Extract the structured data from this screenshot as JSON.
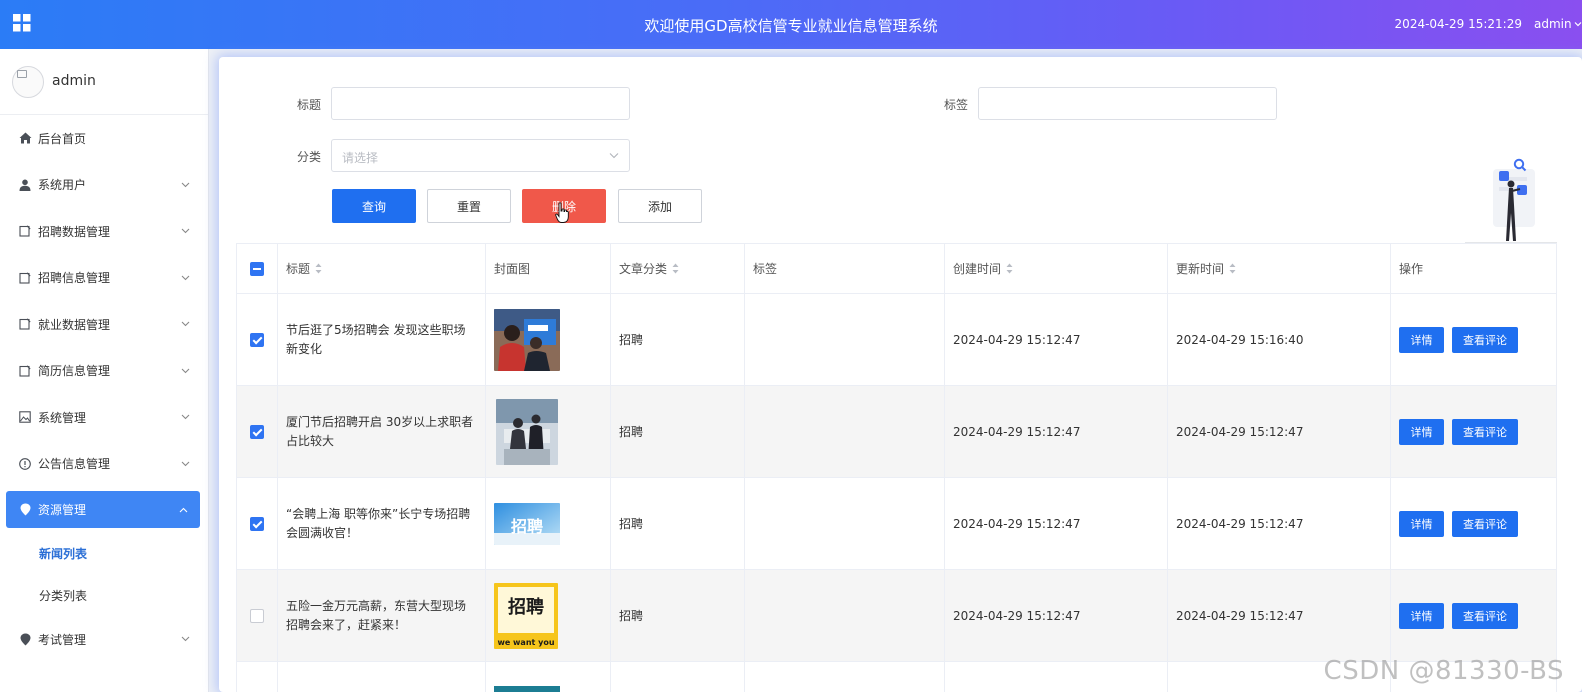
{
  "header": {
    "title": "欢迎使用GD高校信管专业就业信息管理系统",
    "datetime": "2024-04-29 15:21:29",
    "user": "admin"
  },
  "sidebar": {
    "username": "admin",
    "items": [
      {
        "label": "后台首页",
        "icon": "home-icon"
      },
      {
        "label": "系统用户",
        "icon": "user-icon"
      },
      {
        "label": "招聘数据管理",
        "icon": "document-icon"
      },
      {
        "label": "招聘信息管理",
        "icon": "document-icon"
      },
      {
        "label": "就业数据管理",
        "icon": "document-icon"
      },
      {
        "label": "简历信息管理",
        "icon": "document-icon"
      },
      {
        "label": "系统管理",
        "icon": "image-icon"
      },
      {
        "label": "公告信息管理",
        "icon": "info-icon"
      },
      {
        "label": "资源管理",
        "icon": "location-icon"
      },
      {
        "label": "考试管理",
        "icon": "location-icon"
      }
    ],
    "submenu": [
      "新闻列表",
      "分类列表"
    ]
  },
  "search": {
    "title_label": "标题",
    "tag_label": "标签",
    "category_label": "分类",
    "category_placeholder": "请选择",
    "query_label": "查询",
    "reset_label": "重置",
    "delete_label": "删除",
    "add_label": "添加"
  },
  "table": {
    "headers": [
      "标题",
      "封面图",
      "文章分类",
      "标签",
      "创建时间",
      "更新时间",
      "操作"
    ],
    "rows": [
      {
        "checked": true,
        "title": "节后逛了5场招聘会 发现这些职场新变化",
        "category": "招聘",
        "tag": "",
        "created": "2024-04-29 15:12:47",
        "updated": "2024-04-29 15:16:40"
      },
      {
        "checked": true,
        "title": "厦门节后招聘开启 30岁以上求职者占比较大",
        "category": "招聘",
        "tag": "",
        "created": "2024-04-29 15:12:47",
        "updated": "2024-04-29 15:12:47"
      },
      {
        "checked": true,
        "title": "“会聘上海 职等你来”长宁专场招聘会圆满收官！",
        "category": "招聘",
        "tag": "",
        "created": "2024-04-29 15:12:47",
        "updated": "2024-04-29 15:12:47"
      },
      {
        "checked": false,
        "title": "五险一金万元高薪，东营大型现场招聘会来了，赶紧来！",
        "category": "招聘",
        "tag": "",
        "created": "2024-04-29 15:12:47",
        "updated": "2024-04-29 15:12:47"
      }
    ],
    "detail_label": "详情",
    "comments_label": "查看评论"
  },
  "thumb_texts": {
    "poster3": "招聘",
    "poster4_big": "招聘",
    "poster4_small": "we want you"
  },
  "watermark": "CSDN @81330-BS",
  "colors": {
    "header_gradient_start": "#2b7cf6",
    "header_gradient_end": "#8a4ff0",
    "primary": "#1f6ff0",
    "danger": "#f0584a",
    "active_menu": "#3f86f4"
  }
}
